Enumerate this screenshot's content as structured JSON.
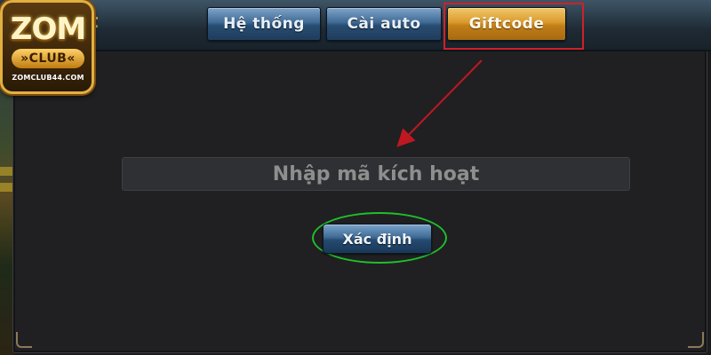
{
  "logo": {
    "brand": "ZOM",
    "sub": "»CLUB«",
    "url": "ZOMCLUB44.COM"
  },
  "header": {
    "partial_title": "t"
  },
  "tabs": [
    {
      "label": "Hệ thống",
      "active": false
    },
    {
      "label": "Cài auto",
      "active": false
    },
    {
      "label": "Giftcode",
      "active": true
    }
  ],
  "giftcode": {
    "placeholder": "Nhập mã kích hoạt",
    "value": "",
    "confirm_label": "Xác định"
  },
  "colors": {
    "highlight_box": "#d0202a",
    "arrow": "#c01820",
    "confirm_ring": "#1fbf2a",
    "tab_active": "#d99a2c",
    "tab_inactive": "#3f6a94"
  }
}
